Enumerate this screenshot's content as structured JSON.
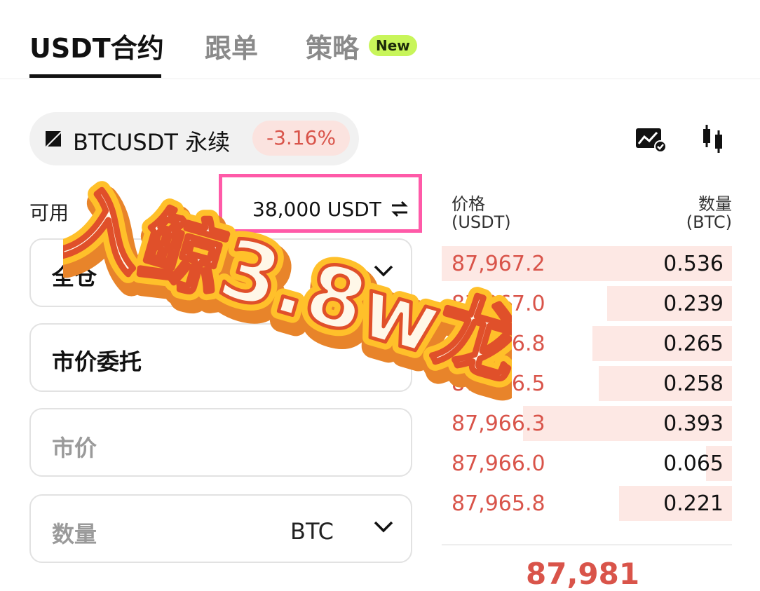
{
  "tabs": [
    {
      "label": "USDT合约",
      "active": true
    },
    {
      "label": "跟单",
      "active": false
    },
    {
      "label": "策略",
      "active": false,
      "badge": "New"
    }
  ],
  "symbol": {
    "name": "BTCUSDT  永续",
    "change": "-3.16%",
    "change_color": "#d9544a"
  },
  "available": {
    "label": "可用",
    "value": "38,000 USDT"
  },
  "form": {
    "margin_mode": "全仓",
    "order_type": "市价委托",
    "price_placeholder": "市价",
    "quantity_placeholder": "数量",
    "quantity_unit": "BTC"
  },
  "orderbook": {
    "price_header": [
      "价格",
      "(USDT)"
    ],
    "qty_header": [
      "数量",
      "(BTC)"
    ],
    "rows": [
      {
        "price": "87,967.2",
        "qty": "0.536",
        "depth": 1.0
      },
      {
        "price": "87,967.0",
        "qty": "0.239",
        "depth": 0.43
      },
      {
        "price": "87,966.8",
        "qty": "0.265",
        "depth": 0.48
      },
      {
        "price": "87,966.5",
        "qty": "0.258",
        "depth": 0.46
      },
      {
        "price": "87,966.3",
        "qty": "0.393",
        "depth": 0.72
      },
      {
        "price": "87,966.0",
        "qty": "0.065",
        "depth": 0.09
      },
      {
        "price": "87,965.8",
        "qty": "0.221",
        "depth": 0.39
      }
    ],
    "last_price": "87,981"
  },
  "overlay": {
    "text": "入鲸3.8w龙"
  },
  "colors": {
    "sell": "#d9544a",
    "depth": "#fde8e4",
    "highlight": "#ff5aa8",
    "new_badge": "#c8f55a"
  }
}
